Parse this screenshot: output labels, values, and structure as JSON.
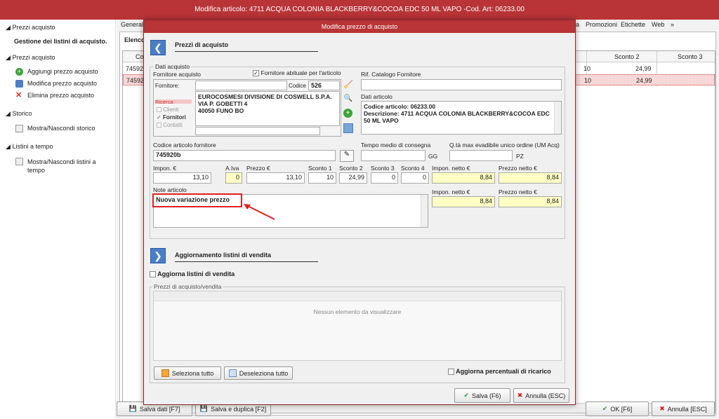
{
  "window_title": "Modifica articolo: 4711 ACQUA COLONIA BLACKBERRY&COCOA EDC 50 ML VAPO -Cod. Art: 06233.00",
  "sidebar": {
    "sections": [
      {
        "title": "Prezzi acquisto",
        "subtitle": "Gestione dei listini di acquisto."
      },
      {
        "title": "Prezzi acquisto",
        "items": [
          "Aggiungi prezzo acquisto",
          "Modifica prezzo acquisto",
          "Elimina prezzo acquisto"
        ]
      },
      {
        "title": "Storico",
        "items": [
          "Mostra/Nascondi storico"
        ]
      },
      {
        "title": "Listini a tempo",
        "items": [
          "Mostra/Nascondi listini a tempo"
        ]
      }
    ]
  },
  "main": {
    "tabs": [
      "Generale",
      "ia",
      "Promozioni",
      "Etichette",
      "Web"
    ],
    "tab_more": "»",
    "list_label": "Elenco",
    "columns": [
      "Co",
      "Sconto 2",
      "Sconto 3"
    ],
    "rows": [
      {
        "code": "745920",
        "val1": "10",
        "val2": "24,99"
      },
      {
        "code": "745920",
        "val1": "10",
        "val2": "24,99"
      }
    ],
    "buttons": {
      "save": "Salva dati [F7]",
      "save_dup": "Salva e duplica [F2]",
      "ok": "OK [F6]",
      "cancel": "Annulla [ESC]"
    }
  },
  "dialog": {
    "title": "Modifica prezzo di acquisto",
    "section1": "Prezzi di acquisto",
    "dati_acquisto": "Dati acquisto",
    "fornitore_acquisto": "Fornitore acquisto",
    "fornitore_abituale": "Fornitore abituale per l'articolo",
    "fornitore_label": "Fornitore:",
    "codice_label": "Codice",
    "codice_value": "526",
    "supplier_lines": [
      "EUROCOSMESI DIVISIONE DI COSWELL S.P.A.",
      "VIA P. GOBETTI 4",
      "40050 FUNO  BO"
    ],
    "ricerca": "Ricerca",
    "ricerca_opts": [
      "Clienti",
      "Fornitori",
      "Contatti"
    ],
    "rif_catalogo": "Rif. Catalogo Fornitore",
    "dati_articolo": "Dati articolo",
    "articolo_lines": [
      "Codice articolo: 06233.00",
      "Descrizione: 4711 ACQUA COLONIA BLACKBERRY&COCOA EDC",
      "50 ML VAPO"
    ],
    "codice_art_forn_label": "Codice articolo fornitore",
    "codice_art_forn": "745920b",
    "tempo_medio": "Tempo medio di consegna",
    "gg": "GG",
    "qta_max": "Q.tà max evadibile unico ordine (UM Acq)",
    "pz": "PZ",
    "price_labels": [
      "Impon. €",
      "A.Iva",
      "Prezzo €",
      "Sconto 1",
      "Sconto 2",
      "Sconto 3",
      "Sconto 4",
      "Impon. netto €",
      "Prezzo netto €"
    ],
    "price_values": [
      "13,10",
      "0",
      "13,10",
      "10",
      "24,99",
      "0",
      "0",
      "8,84",
      "8,84"
    ],
    "note_label": "Note articolo",
    "note_text": "Nuova variazione prezzo",
    "impon_netto2": "Impon. netto €",
    "prezzo_netto2": "Prezzo netto €",
    "netto2_values": [
      "8,84",
      "8,84"
    ],
    "section2": "Aggiornamento listini di vendita",
    "aggiorna_listini": "Aggiorna listini di vendita",
    "prezzi_acq_vend": "Prezzi di acquisto/vendita",
    "empty_msg": "Nessun elemento da visualizzare",
    "sel_all": "Seleziona tutto",
    "desel_all": "Deseleziona tutto",
    "aggiorna_perc": "Aggiorna percentuali di ricarico",
    "salva": "Salva (F6)",
    "annulla": "Annulla (ESC)"
  },
  "colors": {
    "accent": "#b83437",
    "highlight_row": "#f7d7d7",
    "yellow_field": "#ffffc4",
    "annotation": "#e0201e"
  }
}
